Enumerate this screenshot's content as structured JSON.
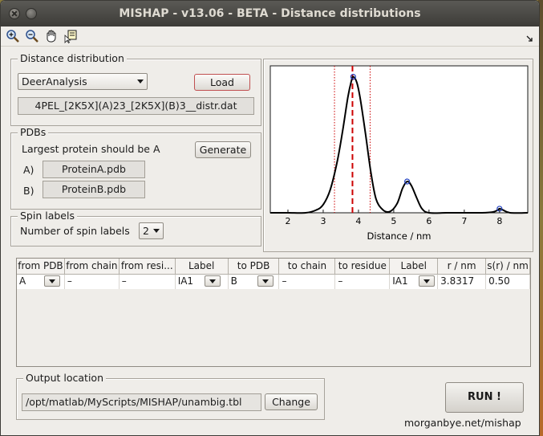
{
  "window": {
    "title": "MISHAP - v13.06 - BETA - Distance distributions"
  },
  "toolbar": {
    "icons": [
      "zoom-in-icon",
      "zoom-out-icon",
      "pan-hand-icon",
      "data-cursor-icon"
    ]
  },
  "distance_panel": {
    "title": "Distance distribution",
    "source_select": "DeerAnalysis",
    "load_label": "Load",
    "filename": "4PEL_[2K5X](A)23_[2K5X](B)3__distr.dat"
  },
  "pdbs_panel": {
    "title": "PDBs",
    "hint": "Largest protein should be A",
    "generate_label": "Generate",
    "a_label": "A)",
    "a_file": "ProteinA.pdb",
    "b_label": "B)",
    "b_file": "ProteinB.pdb"
  },
  "spin_panel": {
    "title": "Spin labels",
    "count_label": "Number of spin labels",
    "count_value": "2"
  },
  "plot": {
    "xlabel": "Distance / nm",
    "xticks": [
      "2",
      "3",
      "4",
      "5",
      "6",
      "7",
      "8"
    ],
    "line_color": "#000000",
    "marker_line_color": "#cc0000",
    "fit_marker_color": "#1f3fbf"
  },
  "chart_data": {
    "type": "line",
    "xlabel": "Distance / nm",
    "ylabel": "",
    "xlim": [
      1.5,
      8.8
    ],
    "ylim": [
      0,
      1.08
    ],
    "x": [
      1.5,
      2.0,
      2.5,
      2.8,
      3.0,
      3.2,
      3.4,
      3.55,
      3.7,
      3.8,
      3.85,
      3.95,
      4.05,
      4.2,
      4.35,
      4.5,
      4.7,
      4.9,
      5.1,
      5.25,
      5.38,
      5.5,
      5.65,
      5.8,
      6.0,
      6.5,
      7.0,
      7.5,
      7.8,
      7.95,
      8.0,
      8.1,
      8.3,
      8.8
    ],
    "y": [
      0.0,
      0.0,
      0.0,
      0.02,
      0.06,
      0.17,
      0.38,
      0.6,
      0.85,
      0.97,
      1.0,
      0.96,
      0.84,
      0.58,
      0.3,
      0.1,
      0.02,
      0.01,
      0.07,
      0.18,
      0.23,
      0.2,
      0.11,
      0.03,
      0.0,
      0.0,
      0.0,
      0.0,
      0.005,
      0.02,
      0.03,
      0.02,
      0.0,
      0.0
    ],
    "vertical_lines": [
      {
        "x": 3.32,
        "style": "dotted"
      },
      {
        "x": 3.83,
        "style": "dashed"
      },
      {
        "x": 4.33,
        "style": "dotted"
      }
    ],
    "circle_markers": [
      {
        "x": 3.85,
        "y": 1.0
      },
      {
        "x": 5.38,
        "y": 0.23
      },
      {
        "x": 8.0,
        "y": 0.03
      }
    ]
  },
  "table": {
    "headers": [
      "from PDB",
      "from chain",
      "from resi...",
      "Label",
      "to PDB",
      "to chain",
      "to residue",
      "Label",
      "r / nm",
      "s(r) / nm"
    ],
    "rows": [
      [
        "A",
        "–",
        "–",
        "IA1",
        "B",
        "–",
        "–",
        "IA1",
        "3.8317",
        "0.50"
      ]
    ]
  },
  "output_panel": {
    "title": "Output location",
    "path": "/opt/matlab/MyScripts/MISHAP/unambig.tbl",
    "change_label": "Change"
  },
  "run_label": "RUN !",
  "footer": "morganbye.net/mishap"
}
